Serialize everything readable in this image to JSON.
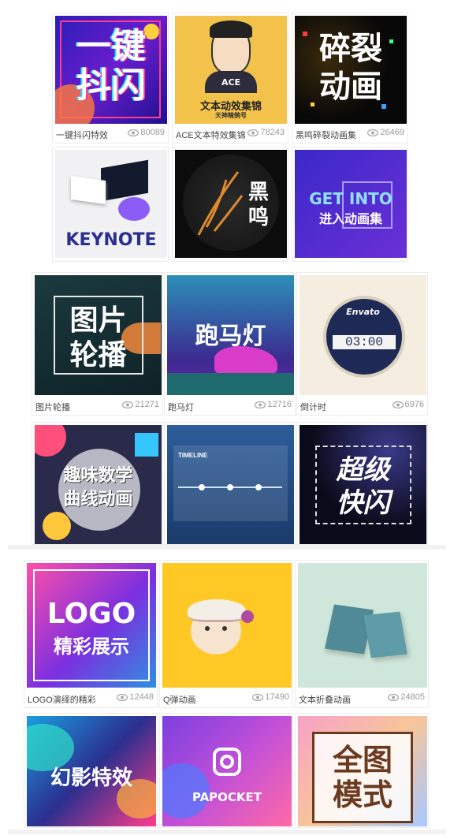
{
  "colors": {
    "accent_yellow": "#f3c24b",
    "purple": "#5b2bd6",
    "navy": "#1e2a55"
  },
  "group1": [
    {
      "thumb_text": "一键\n抖闪",
      "title": "一键抖闪特效",
      "views": "80089"
    },
    {
      "thumb_text": "ACE",
      "thumb_sub": "文本动效集锦",
      "thumb_sub2": "天神睛鹄号",
      "title": "ACE文本特效集锦",
      "views": "78243"
    },
    {
      "thumb_text": "碎裂\n动画",
      "title": "黑鸣碎裂动画集",
      "views": "26469"
    },
    {
      "thumb_text": "KEYNOTE",
      "title": "",
      "views": ""
    },
    {
      "thumb_text": "黑\n鸣",
      "title": "",
      "views": ""
    },
    {
      "thumb_text": "GET INTO",
      "thumb_sub": "进入动画集",
      "title": "",
      "views": ""
    }
  ],
  "group2": [
    {
      "thumb_text": "图片\n轮播",
      "title": "图片轮播",
      "views": "21271"
    },
    {
      "thumb_text": "跑马灯",
      "title": "跑马灯",
      "views": "12716"
    },
    {
      "thumb_text": "Envato",
      "thumb_sub": "03:00",
      "title": "倒计时",
      "views": "6976"
    },
    {
      "thumb_text": "趣味数学\n曲线动画",
      "title": "",
      "views": ""
    },
    {
      "thumb_text": "TIMELINE",
      "title": "",
      "views": ""
    },
    {
      "thumb_text": "超级\n快闪",
      "title": "",
      "views": ""
    }
  ],
  "group3": [
    {
      "thumb_text": "LOGO",
      "thumb_sub": "精彩展示",
      "title": "LOGO演绎的精彩",
      "views": "12448"
    },
    {
      "thumb_text": "",
      "title": "Q弹动画",
      "views": "17490"
    },
    {
      "thumb_text": "",
      "title": "文本折叠动画",
      "views": "24805"
    },
    {
      "thumb_text": "幻影特效",
      "title": "",
      "views": ""
    },
    {
      "thumb_text": "PAPOCKET",
      "title": "",
      "views": ""
    },
    {
      "thumb_text": "全图\n模式",
      "title": "",
      "views": ""
    }
  ]
}
